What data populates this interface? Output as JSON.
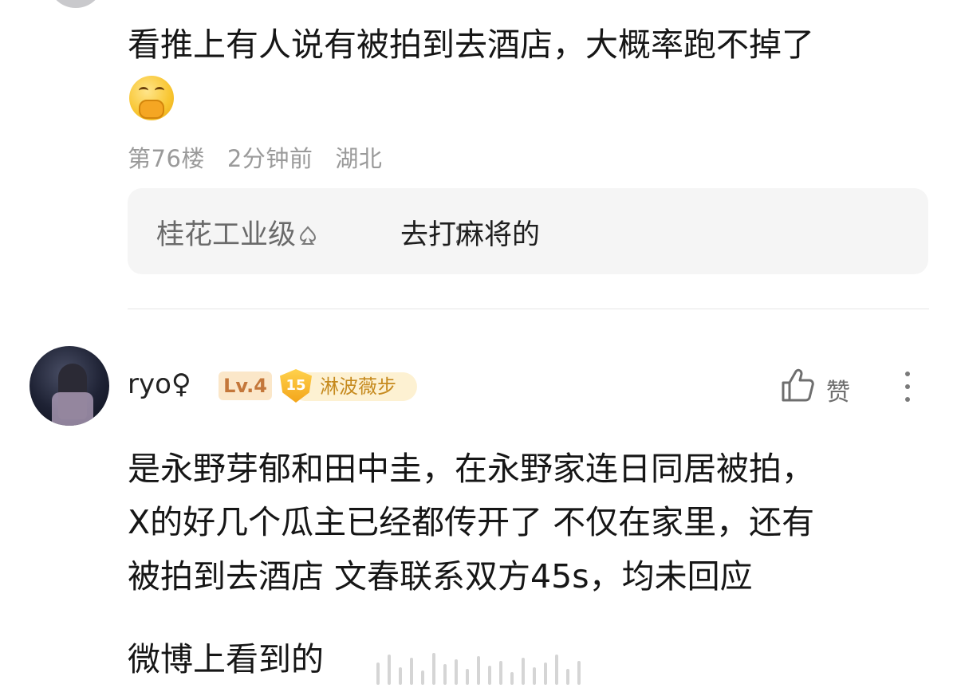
{
  "previous_comment": {
    "text_lines": [
      "看推上有人说有被拍到去酒店，大概率跑不掉了"
    ],
    "emoji_icon": "face-with-hand-over-mouth-emoji",
    "meta": {
      "floor": "第76楼",
      "time": "2分钟前",
      "location": "湖北"
    },
    "reply": {
      "author": "桂花工业级",
      "author_icon": "spade-suit-icon",
      "separator": "：",
      "text": "去打麻将的"
    }
  },
  "comment": {
    "username": "ryo",
    "gender_symbol": "♀",
    "level_badge": "Lv.4",
    "fan_badge": {
      "level": "15",
      "label": "淋波薇步"
    },
    "like_label": "赞",
    "text_lines": [
      "是永野芽郁和田中圭，在永野家连日同居被拍，",
      "X的好几个瓜主已经都传开了 不仅在家里，还有",
      "被拍到去酒店 文春联系双方45s，均未回应"
    ],
    "footer_text": "微博上看到的"
  },
  "colors": {
    "text": "#161616",
    "meta_gray": "#9a9a9a",
    "reply_bg": "#f5f5f5",
    "level_badge_bg": "#fbe7c9",
    "level_badge_text": "#c4773a",
    "fan_badge_bg": "#fdf1d2",
    "fan_badge_text": "#c68a1e"
  }
}
